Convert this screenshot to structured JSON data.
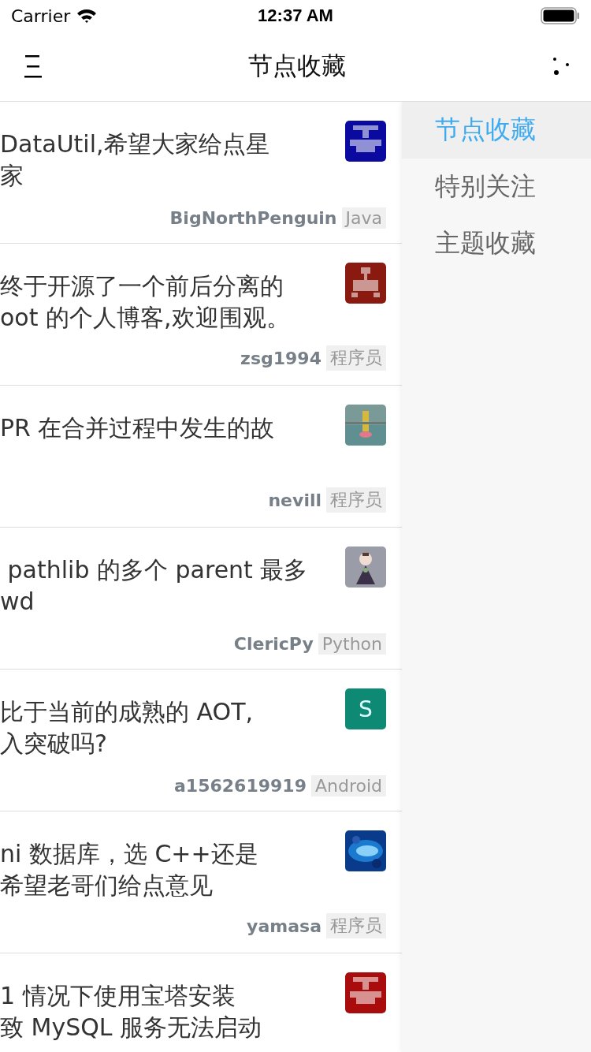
{
  "status_bar": {
    "carrier": "Carrier",
    "time": "12:37 AM"
  },
  "nav": {
    "title": "节点收藏"
  },
  "topics": [
    {
      "title_lines": [
        "DataUtil,希望大家给点星",
        "家"
      ],
      "author": "BigNorthPenguin",
      "node": "Java",
      "avatar": {
        "kind": "identicon",
        "color": "#0a0aa0"
      }
    },
    {
      "title_lines": [
        "终于开源了一个前后分离的",
        "oot 的个人博客,欢迎围观。"
      ],
      "author": "zsg1994",
      "node": "程序员",
      "avatar": {
        "kind": "identicon",
        "color": "#8a1a10"
      }
    },
    {
      "title_lines": [
        "PR 在合并过程中发生的故"
      ],
      "author": "nevill",
      "node": "程序员",
      "avatar": {
        "kind": "picture"
      }
    },
    {
      "title_lines": [
        " pathlib 的多个 parent 最多",
        "wd"
      ],
      "author": "ClericPy",
      "node": "Python",
      "avatar": {
        "kind": "picture"
      }
    },
    {
      "title_lines": [
        "比于当前的成熟的 AOT,",
        "入突破吗?"
      ],
      "author": "a1562619919",
      "node": "Android",
      "avatar": {
        "kind": "letter",
        "letter": "S",
        "color": "#0e8a74"
      }
    },
    {
      "title_lines": [
        "ni 数据库，选 C++还是",
        "希望老哥们给点意见"
      ],
      "author": "yamasa",
      "node": "程序员",
      "avatar": {
        "kind": "picture"
      }
    },
    {
      "title_lines": [
        "1 情况下使用宝塔安装",
        "致 MySQL 服务无法启动"
      ],
      "avatar": {
        "kind": "identicon",
        "color": "#a80c0c"
      }
    }
  ],
  "drawer": {
    "items": [
      {
        "label": "节点收藏",
        "selected": true
      },
      {
        "label": "特别关注",
        "selected": false
      },
      {
        "label": "主题收藏",
        "selected": false
      }
    ]
  }
}
